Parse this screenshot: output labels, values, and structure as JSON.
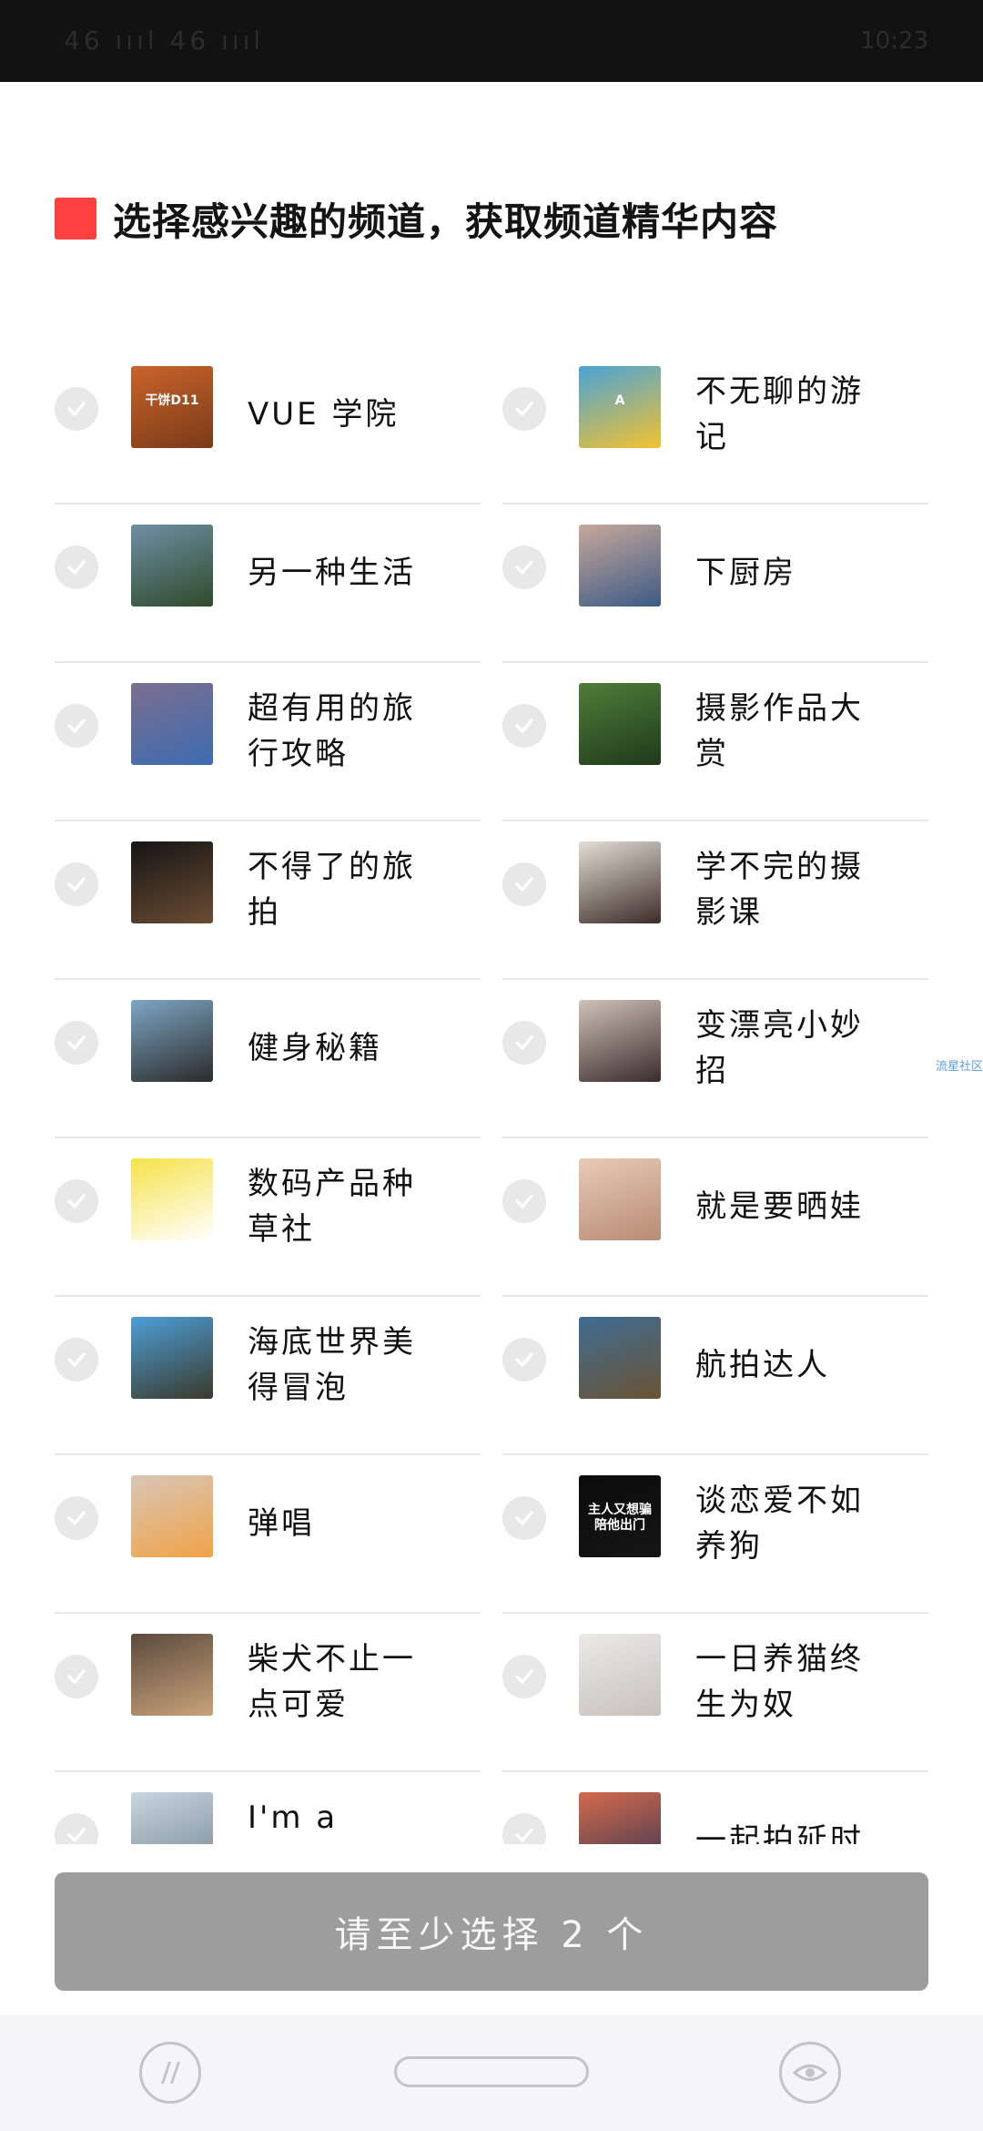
{
  "status_bar": {
    "left": "46 ıııl 46 ıııl",
    "time": "10:23"
  },
  "header": {
    "title": "选择感兴趣的频道，获取频道精华内容",
    "accent": "#ff4040"
  },
  "channels": [
    {
      "label": "VUE 学院",
      "thumb_text": "干饼D11",
      "thumb_colors": [
        "#c9632a",
        "#7a3b18"
      ]
    },
    {
      "label": "不无聊的游记",
      "thumb_text": "A",
      "thumb_colors": [
        "#4aa3d8",
        "#f2c230"
      ]
    },
    {
      "label": "另一种生活",
      "thumb_text": "",
      "thumb_colors": [
        "#6f8fa6",
        "#2f4a2a"
      ]
    },
    {
      "label": "下厨房",
      "thumb_text": "",
      "thumb_colors": [
        "#c7a89a",
        "#3d5a86"
      ]
    },
    {
      "label": "超有用的旅行攻略",
      "thumb_text": "",
      "thumb_colors": [
        "#7c6f8f",
        "#3d6bb0"
      ]
    },
    {
      "label": "摄影作品大赏",
      "thumb_text": "",
      "thumb_colors": [
        "#4f7d3a",
        "#1f3a1b"
      ]
    },
    {
      "label": "不得了的旅拍",
      "thumb_text": "",
      "thumb_colors": [
        "#151515",
        "#6b4c33"
      ]
    },
    {
      "label": "学不完的摄影课",
      "thumb_text": "",
      "thumb_colors": [
        "#e6ddd6",
        "#3b2c28"
      ]
    },
    {
      "label": "健身秘籍",
      "thumb_text": "",
      "thumb_colors": [
        "#7da6c4",
        "#2b2b2b"
      ]
    },
    {
      "label": "变漂亮小妙招",
      "thumb_text": "",
      "thumb_colors": [
        "#cfc2b8",
        "#3a2c2b"
      ]
    },
    {
      "label": "数码产品种草社",
      "thumb_text": "",
      "thumb_colors": [
        "#f6e24a",
        "#ffffff"
      ]
    },
    {
      "label": "就是要晒娃",
      "thumb_text": "",
      "thumb_colors": [
        "#e8cbb7",
        "#b88b73"
      ]
    },
    {
      "label": "海底世界美得冒泡",
      "thumb_text": "",
      "thumb_colors": [
        "#4d9ed8",
        "#3a3a2a"
      ]
    },
    {
      "label": "航拍达人",
      "thumb_text": "",
      "thumb_colors": [
        "#3f6c93",
        "#6a5434"
      ]
    },
    {
      "label": "弹唱",
      "thumb_text": "",
      "thumb_colors": [
        "#d8c6b8",
        "#f0a346"
      ]
    },
    {
      "label": "谈恋爱不如养狗",
      "thumb_text": "主人又想骗\n陪他出门",
      "thumb_colors": [
        "#0c0c0c",
        "#151515"
      ]
    },
    {
      "label": "柴犬不止一点可爱",
      "thumb_text": "",
      "thumb_colors": [
        "#5b4a3d",
        "#c9a27a"
      ]
    },
    {
      "label": "一日养猫终生为奴",
      "thumb_text": "",
      "thumb_colors": [
        "#eaeaea",
        "#c7c1ba"
      ]
    },
    {
      "label": "I'm a Vlogger",
      "thumb_text": "",
      "thumb_colors": [
        "#c9d5df",
        "#7a8a96"
      ]
    },
    {
      "label": "一起拍延时",
      "thumb_text": "",
      "thumb_colors": [
        "#d56b4c",
        "#3a3552"
      ]
    }
  ],
  "side_note": "流星社区",
  "submit_button": {
    "label": "请至少选择 2 个",
    "color": "#9d9d9d"
  },
  "nav": {
    "left_icon": "app-logo-icon",
    "right_icon": "eye-icon"
  }
}
